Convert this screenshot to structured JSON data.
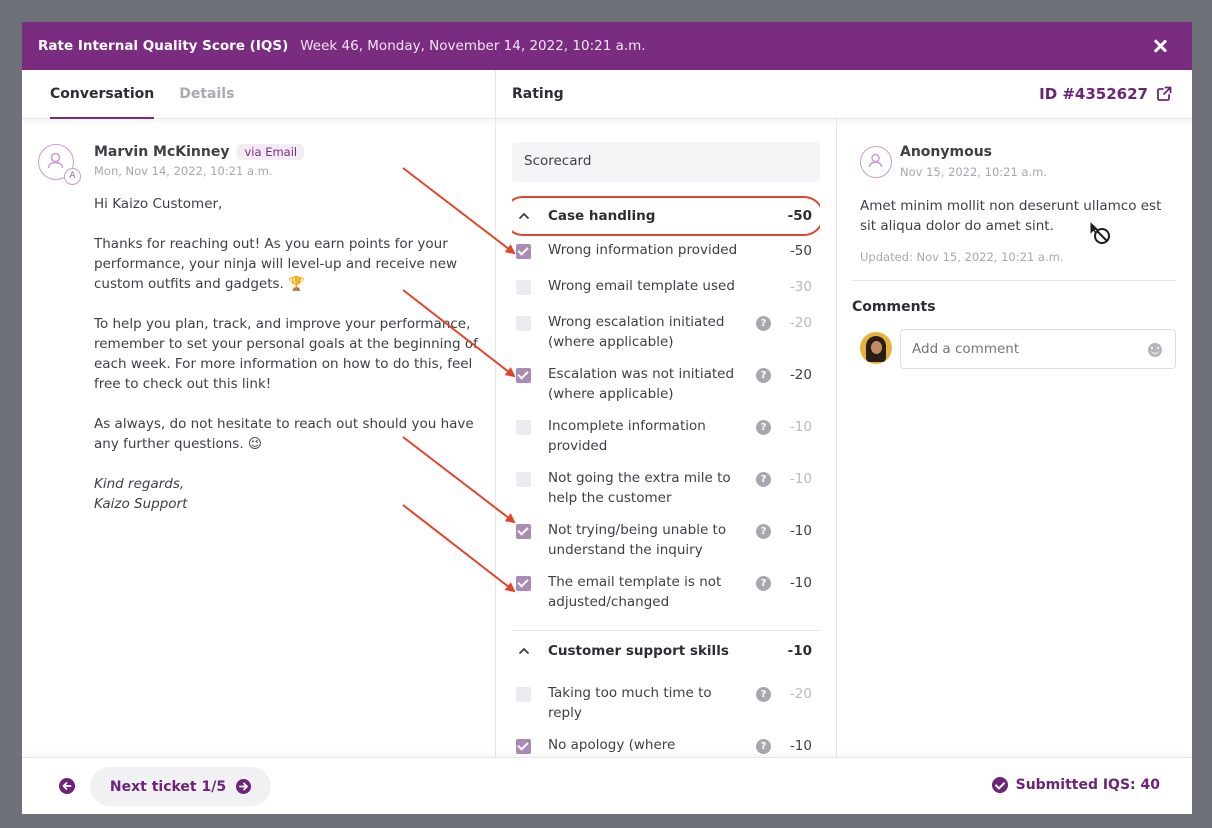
{
  "header": {
    "title": "Rate Internal Quality Score (IQS)",
    "subtitle": "Week 46, Monday, November 14, 2022, 10:21 a.m."
  },
  "tabs": [
    {
      "label": "Conversation",
      "active": true
    },
    {
      "label": "Details",
      "active": false
    }
  ],
  "rating_header": "Rating",
  "ticket_id": "ID #4352627",
  "conversation": {
    "sender": "Marvin McKinney",
    "channel": "via Email",
    "avatar_badge": "A",
    "date": "Mon, Nov 14, 2022, 10:21 a.m.",
    "paragraphs": [
      "Hi Kaizo Customer,",
      "Thanks for reaching out! As you earn points for your performance, your ninja will level-up and receive new custom outfits and gadgets. 🏆",
      "To help you plan, track, and improve your performance, remember to set your personal goals at the beginning of each week. For more information on how to do this, feel free to check out this link!",
      "As always, do not hesitate to reach out should you have any further questions. 😉"
    ],
    "signoff": "Kind regards,",
    "signature": "Kaizo Support"
  },
  "scorecard_label": "Scorecard",
  "sections": [
    {
      "label": "Case handling",
      "score": "-50",
      "items": [
        {
          "label": "Wrong information provided",
          "points": "-50",
          "checked": true,
          "help": false
        },
        {
          "label": "Wrong email template used",
          "points": "-30",
          "checked": false,
          "help": false
        },
        {
          "label": "Wrong escalation initiated (where applicable)",
          "points": "-20",
          "checked": false,
          "help": true
        },
        {
          "label": "Escalation was not initiated (where applicable)",
          "points": "-20",
          "checked": true,
          "help": true
        },
        {
          "label": "Incomplete information provided",
          "points": "-10",
          "checked": false,
          "help": true
        },
        {
          "label": "Not going the extra mile to help the customer",
          "points": "-10",
          "checked": false,
          "help": true
        },
        {
          "label": "Not trying/being unable to understand the inquiry",
          "points": "-10",
          "checked": true,
          "help": true
        },
        {
          "label": "The email template is not adjusted/changed",
          "points": "-10",
          "checked": true,
          "help": true
        }
      ]
    },
    {
      "label": "Customer support skills",
      "score": "-10",
      "items": [
        {
          "label": "Taking too much time to reply",
          "points": "-20",
          "checked": false,
          "help": true
        },
        {
          "label": "No apology (where",
          "points": "-10",
          "checked": true,
          "help": true
        }
      ]
    }
  ],
  "review": {
    "author": "Anonymous",
    "date": "Nov 15, 2022, 10:21 a.m.",
    "text": "Amet minim mollit non deserunt ullamco est sit aliqua dolor do amet sint.",
    "updated": "Updated: Nov 15, 2022, 10:21 a.m."
  },
  "comments": {
    "heading": "Comments",
    "placeholder": "Add a comment"
  },
  "footer": {
    "next_label": "Next ticket 1/5",
    "submitted_label": "Submitted IQS: 40"
  },
  "colors": {
    "brand": "#7a2c81",
    "accent": "#6c2378",
    "annotation": "#e0452b",
    "checked": "#a98bb6"
  }
}
